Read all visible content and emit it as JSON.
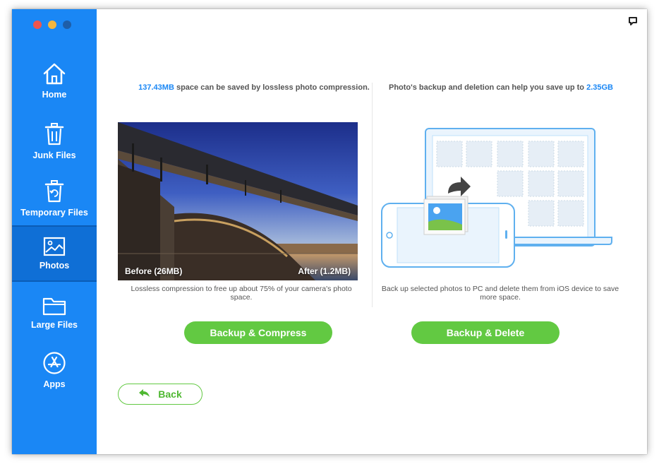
{
  "sidebar": {
    "items": [
      {
        "label": "Home",
        "icon": "home-icon"
      },
      {
        "label": "Junk Files",
        "icon": "trash-icon"
      },
      {
        "label": "Temporary Files",
        "icon": "temp-trash-icon"
      },
      {
        "label": "Photos",
        "icon": "photo-icon",
        "active": true
      },
      {
        "label": "Large Files",
        "icon": "folder-icon"
      },
      {
        "label": "Apps",
        "icon": "app-store-icon"
      }
    ]
  },
  "left_panel": {
    "saved_amount": "137.43MB",
    "caption_rest": " space can be saved by lossless photo compression.",
    "before_label": "Before (26MB)",
    "after_label": "After (1.2MB)",
    "description": "Lossless compression to free up about 75% of your camera's photo space.",
    "button_label": "Backup & Compress"
  },
  "right_panel": {
    "caption_start": "Photo's backup and deletion can help you save up to ",
    "saved_amount": "2.35GB",
    "description": "Back up selected photos to PC and delete them from iOS device to save more space.",
    "button_label": "Backup & Delete"
  },
  "back_button": {
    "label": "Back"
  },
  "colors": {
    "sidebar": "#1a87f5",
    "accent": "#1a87f5",
    "button_green": "#62c942"
  }
}
